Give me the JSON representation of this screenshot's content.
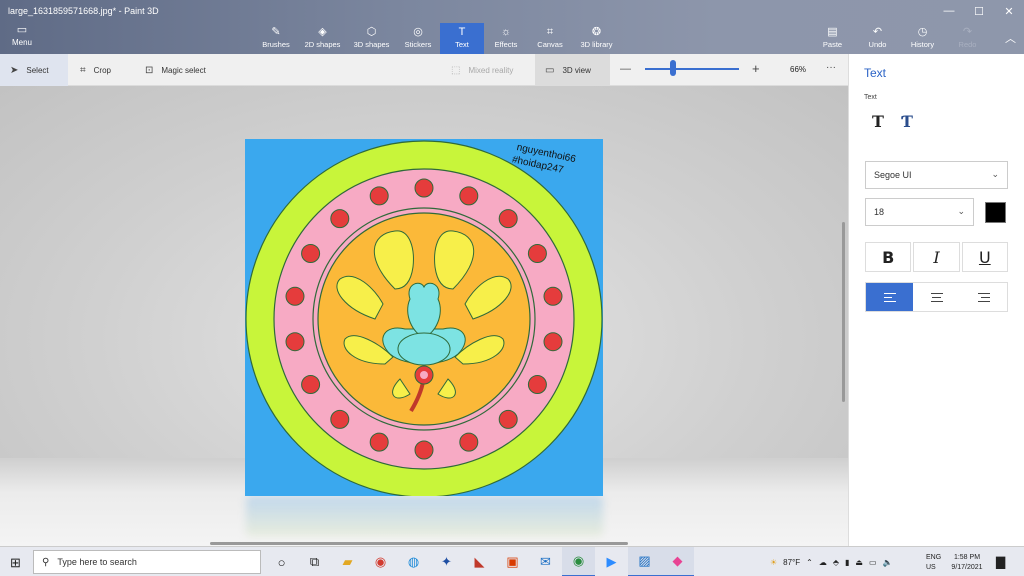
{
  "window": {
    "title": "large_1631859571668.jpg* - Paint 3D",
    "controls": [
      "—",
      "☐",
      "✕"
    ]
  },
  "ribbon": {
    "menu": {
      "icon": "menu-icon",
      "label": "Menu"
    },
    "tools": [
      {
        "label": "Brushes",
        "icon": "brush-icon"
      },
      {
        "label": "2D shapes",
        "icon": "2d-shapes-icon"
      },
      {
        "label": "3D shapes",
        "icon": "3d-shapes-icon"
      },
      {
        "label": "Stickers",
        "icon": "stickers-icon"
      },
      {
        "label": "Text",
        "icon": "text-icon",
        "active": true
      },
      {
        "label": "Effects",
        "icon": "effects-icon"
      },
      {
        "label": "Canvas",
        "icon": "canvas-icon"
      },
      {
        "label": "3D library",
        "icon": "3d-library-icon"
      }
    ],
    "right": [
      {
        "label": "Paste",
        "icon": "paste-icon"
      },
      {
        "label": "Undo",
        "icon": "undo-icon"
      },
      {
        "label": "History",
        "icon": "history-icon"
      },
      {
        "label": "Redo",
        "icon": "redo-icon",
        "disabled": true
      }
    ]
  },
  "subbar": {
    "select": "Select",
    "crop": "Crop",
    "magic_select": "Magic select",
    "mixed_reality": "Mixed reality",
    "view_3d": "3D view",
    "zoom": "66%",
    "zoom_fraction": 0.3,
    "more": "···"
  },
  "canvas": {
    "watermark_line1": "nguyenthoi66",
    "watermark_line2": "#hoidap247",
    "colors": {
      "background": "#3aa8ee",
      "outer_ring": "#c8f53a",
      "pink_ring": "#f7aac4",
      "inner_fill": "#fbb939",
      "dots": "#e53c3c",
      "petals": "#f7ef4a",
      "flower": "#7de3e3"
    }
  },
  "panel": {
    "title": "Text",
    "subtitle": "Text",
    "font": "Segoe UI",
    "size": "18",
    "color": "#000000",
    "bold": "B",
    "italic": "I",
    "underline": "U"
  },
  "taskbar": {
    "search_placeholder": "Type here to search",
    "weather": "87°F",
    "lang1": "ENG",
    "lang2": "US",
    "time": "1:58 PM",
    "date": "9/17/2021"
  }
}
